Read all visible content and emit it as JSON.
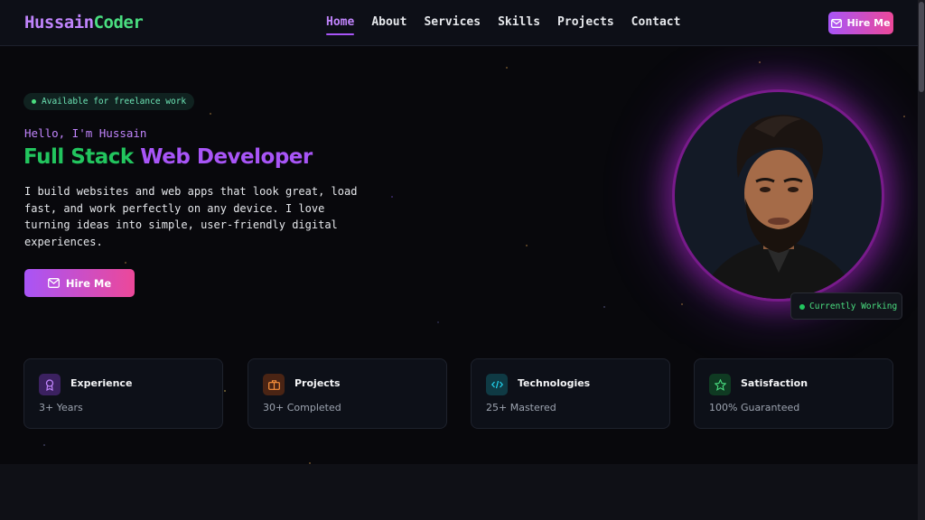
{
  "nav": {
    "logo_first": "Hussain",
    "logo_second": "Coder",
    "links": [
      "Home",
      "About",
      "Services",
      "Skills",
      "Projects",
      "Contact"
    ],
    "active_link": "Home",
    "hire_label": "Hire Me"
  },
  "hero": {
    "badge": "Available for freelance work",
    "greeting": "Hello, I'm Hussain",
    "headline_green": "Full Stack",
    "headline_purple": "Web Developer",
    "description": "I build websites and web apps that look great, load fast, and work perfectly on any device. I love turning ideas into simple, user-friendly digital experiences.",
    "hire_label": "Hire Me",
    "status": "Currently Working"
  },
  "stats": [
    {
      "title": "Experience",
      "value": "3+ Years",
      "icon": "award-icon",
      "color": "#a855f7"
    },
    {
      "title": "Projects",
      "value": "30+ Completed",
      "icon": "briefcase-icon",
      "color": "#f97316"
    },
    {
      "title": "Technologies",
      "value": "25+ Mastered",
      "icon": "code-icon",
      "color": "#22d3ee"
    },
    {
      "title": "Satisfaction",
      "value": "100% Guaranteed",
      "icon": "star-icon",
      "color": "#4ade80"
    }
  ],
  "colors": {
    "accent_purple": "#a855f7",
    "accent_pink": "#ec4899",
    "accent_green": "#22c55e",
    "background": "#08080c"
  }
}
